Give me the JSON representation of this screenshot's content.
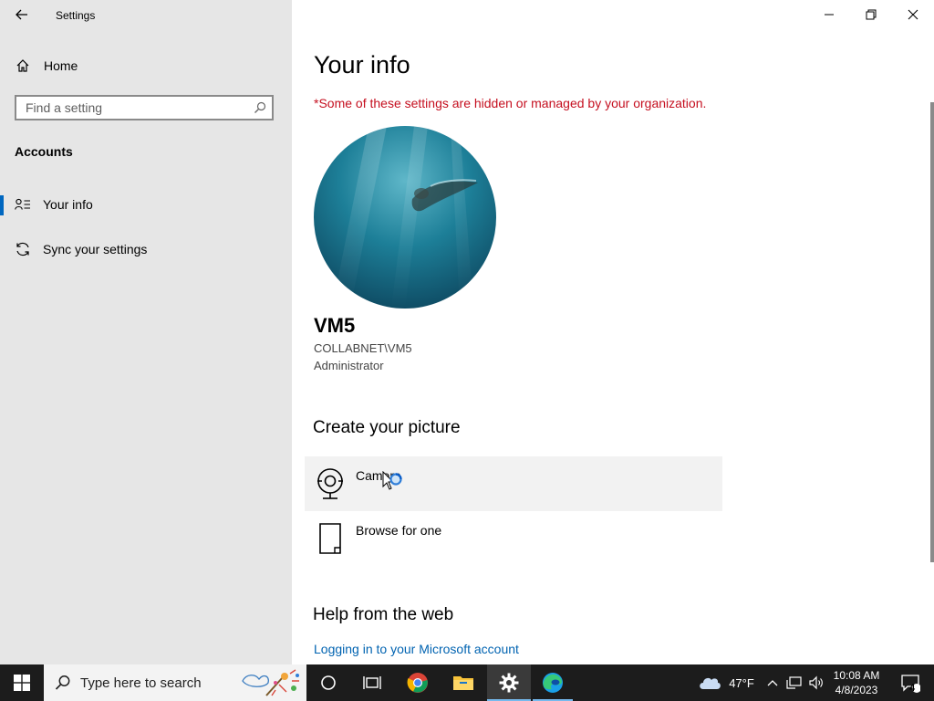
{
  "window": {
    "title": "Settings"
  },
  "sidebar": {
    "home_label": "Home",
    "search_placeholder": "Find a setting",
    "section_title": "Accounts",
    "items": [
      {
        "label": "Your info",
        "icon": "person-list-icon",
        "active": true
      },
      {
        "label": "Sync your settings",
        "icon": "sync-icon",
        "active": false
      }
    ]
  },
  "main": {
    "title": "Your info",
    "org_notice": "*Some of these settings are hidden or managed by your organization.",
    "user": {
      "name": "VM5",
      "domain_account": "COLLABNET\\VM5",
      "role": "Administrator"
    },
    "create_picture": {
      "heading": "Create your picture",
      "options": [
        {
          "label": "Camera",
          "icon": "webcam-icon"
        },
        {
          "label": "Browse for one",
          "icon": "file-icon"
        }
      ]
    },
    "help": {
      "heading": "Help from the web",
      "links": [
        "Logging in to your Microsoft account"
      ]
    }
  },
  "taskbar": {
    "search_placeholder": "Type here to search",
    "weather_temp": "47°F",
    "time": "10:08 AM",
    "date": "4/8/2023",
    "notification_count": "4"
  },
  "colors": {
    "accent": "#0067c0",
    "warning": "#c50f1f",
    "link": "#0063b1",
    "taskbar": "#1c1c1c"
  }
}
